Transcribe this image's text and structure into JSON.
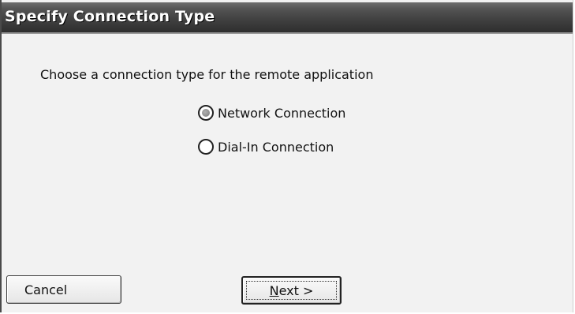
{
  "dialog": {
    "title": "Specify Connection Type",
    "instruction": "Choose a connection type for the remote application",
    "options": [
      {
        "label": "Network Connection",
        "selected": true
      },
      {
        "label": "Dial-In Connection",
        "selected": false
      }
    ],
    "buttons": {
      "cancel_label": "Cancel",
      "next_mnemonic": "N",
      "next_rest": "ext >"
    }
  },
  "colors": {
    "titlebar": "#3f3f3f",
    "title_text": "#ffffff",
    "background": "#f2f2f2"
  }
}
